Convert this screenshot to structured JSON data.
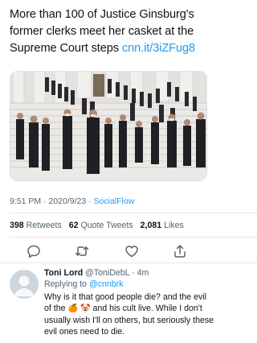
{
  "tweet": {
    "text": "More than 100 of Justice Ginsburg's former clerks meet her casket at the Supreme Court steps ",
    "link": "cnn.it/3iZFug8",
    "time": "9:51 PM",
    "date": "2020/9/23",
    "source": "SocialFlow"
  },
  "stats": {
    "retweets_count": "398",
    "retweets_label": "Retweets",
    "quotes_count": "62",
    "quotes_label": "Quote Tweets",
    "likes_count": "2,081",
    "likes_label": "Likes"
  },
  "actions": [
    "reply-icon",
    "retweet-icon",
    "like-icon",
    "share-icon"
  ],
  "reply": {
    "name": "Toni Lord",
    "handle": "@ToniDebL",
    "age": "4m",
    "replying_prefix": "Replying to ",
    "replying_to": "@cnnbrk",
    "body_part1": "Why is it that good people die? and the evil of the ",
    "emoji": "🍊 🤡",
    "body_part2": " and his cult live. While I don't usually wish I'll on others, but seriously these evil ones need to die."
  },
  "colors": {
    "link": "#1d9bf0",
    "secondary_text": "#536471",
    "primary_text": "#0f1419"
  }
}
